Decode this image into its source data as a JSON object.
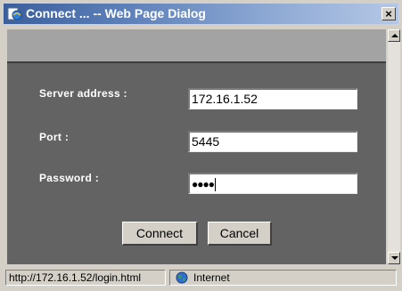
{
  "window": {
    "title": "Connect ... -- Web Page Dialog",
    "close_label": "×",
    "icon": "ie-page-icon"
  },
  "form": {
    "server_address_label": "Server address  :",
    "server_address_value": "172.16.1.52",
    "port_label": "Port  :",
    "port_value": "5445",
    "password_label": "Password  :",
    "password_masked": "●●●●"
  },
  "buttons": {
    "connect_label": "Connect",
    "cancel_label": "Cancel"
  },
  "statusbar": {
    "url": "http://172.16.1.52/login.html",
    "zone": "Internet",
    "zone_icon": "globe-icon"
  },
  "colors": {
    "panel_dark": "#636363",
    "panel_light": "#a3a3a3",
    "chrome": "#d4d0c8",
    "titlebar_start": "#3b5f9c"
  }
}
